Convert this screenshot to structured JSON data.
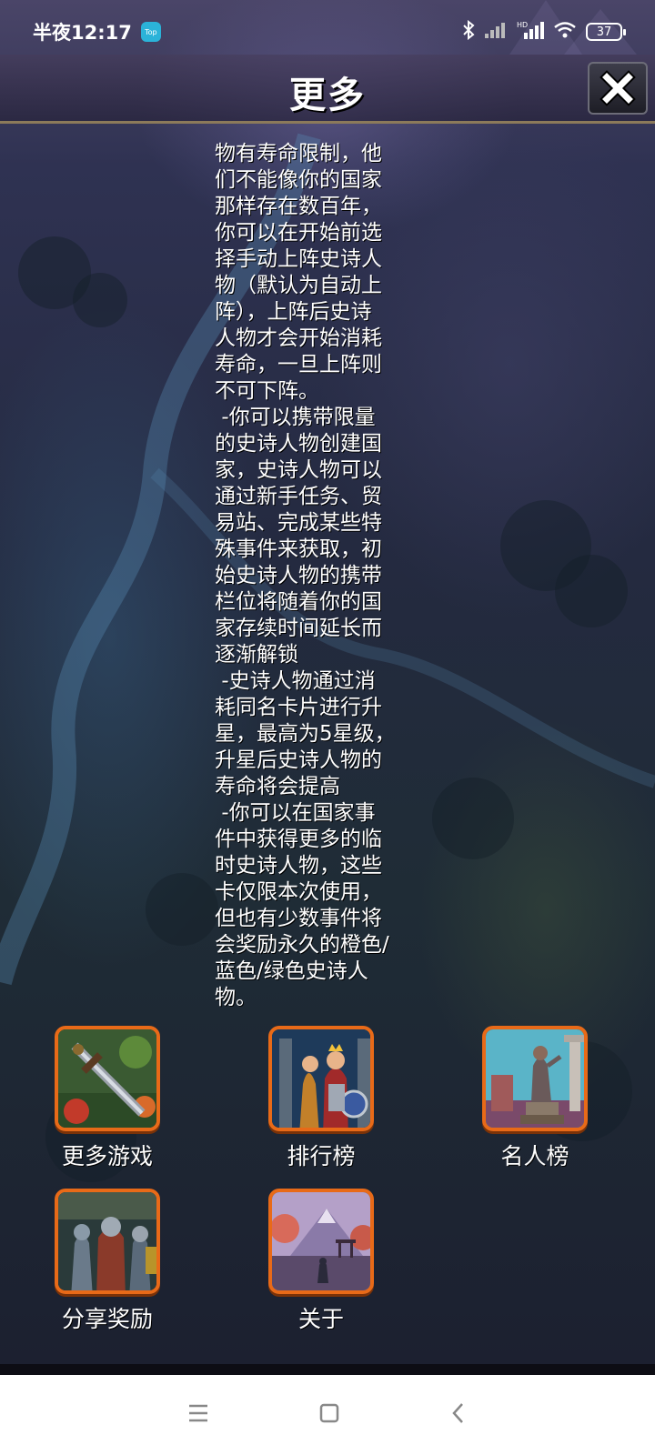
{
  "status_bar": {
    "time": "半夜12:17",
    "app_badge": "Top",
    "battery": "37"
  },
  "header": {
    "title": "更多"
  },
  "description": "物有寿命限制，他\n们不能像你的国家\n那样存在数百年，\n你可以在开始前选\n择手动上阵史诗人\n物（默认为自动上\n阵），上阵后史诗\n人物才会开始消耗\n寿命，一旦上阵则\n不可下阵。\n -你可以携带限量\n的史诗人物创建国\n家，史诗人物可以\n通过新手任务、贸\n易站、完成某些特\n殊事件来获取，初\n始史诗人物的携带\n栏位将随着你的国\n家存续时间延长而\n逐渐解锁\n -史诗人物通过消\n耗同名卡片进行升\n星，最高为5星级，\n升星后史诗人物的\n寿命将会提高\n -你可以在国家事\n件中获得更多的临\n时史诗人物，这些\n卡仅限本次使用，\n但也有少数事件将\n会奖励永久的橙色/\n蓝色/绿色史诗人\n物。",
  "tiles": [
    {
      "label": "更多游戏",
      "icon": "sword-icon"
    },
    {
      "label": "排行榜",
      "icon": "king-knight-icon"
    },
    {
      "label": "名人榜",
      "icon": "statue-icon"
    },
    {
      "label": "分享奖励",
      "icon": "knights-icon"
    },
    {
      "label": "关于",
      "icon": "landscape-icon"
    }
  ],
  "colors": {
    "tile_border": "#e86a18",
    "header_line": "#8c7a5a"
  }
}
